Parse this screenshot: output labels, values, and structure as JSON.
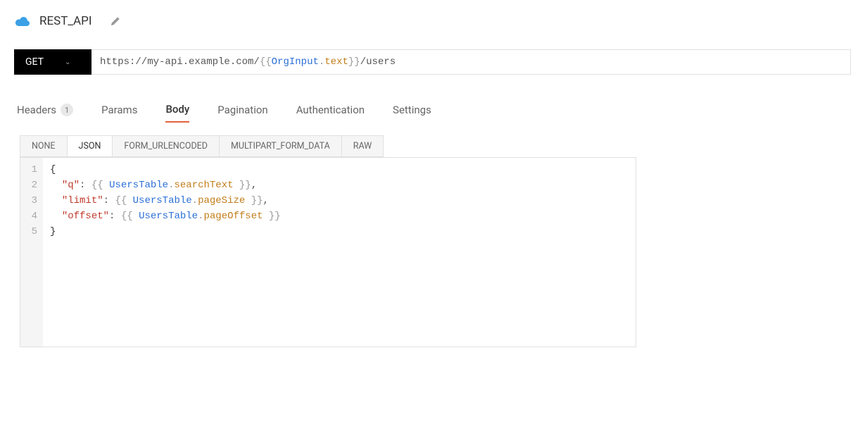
{
  "header": {
    "title": "REST_API"
  },
  "request": {
    "method": "GET",
    "url_prefix": "https://my-api.example.com/",
    "url_binding_obj": "OrgInput",
    "url_binding_prop": "text",
    "url_suffix": "/users"
  },
  "tabs": {
    "headers": {
      "label": "Headers",
      "count": "1"
    },
    "params": {
      "label": "Params"
    },
    "body": {
      "label": "Body",
      "active": true
    },
    "pagination": {
      "label": "Pagination"
    },
    "authentication": {
      "label": "Authentication"
    },
    "settings": {
      "label": "Settings"
    }
  },
  "body_types": {
    "none": "NONE",
    "json": "JSON",
    "form": "FORM_URLENCODED",
    "multipart": "MULTIPART_FORM_DATA",
    "raw": "RAW"
  },
  "code": {
    "lines": [
      "1",
      "2",
      "3",
      "4",
      "5"
    ],
    "rows": [
      {
        "type": "open_brace"
      },
      {
        "type": "kv",
        "key": "\"q\"",
        "obj": "UsersTable",
        "prop": "searchText",
        "trailing_comma": true
      },
      {
        "type": "kv",
        "key": "\"limit\"",
        "obj": "UsersTable",
        "prop": "pageSize",
        "trailing_comma": true
      },
      {
        "type": "kv",
        "key": "\"offset\"",
        "obj": "UsersTable",
        "prop": "pageOffset",
        "trailing_comma": false
      },
      {
        "type": "close_brace"
      }
    ]
  }
}
